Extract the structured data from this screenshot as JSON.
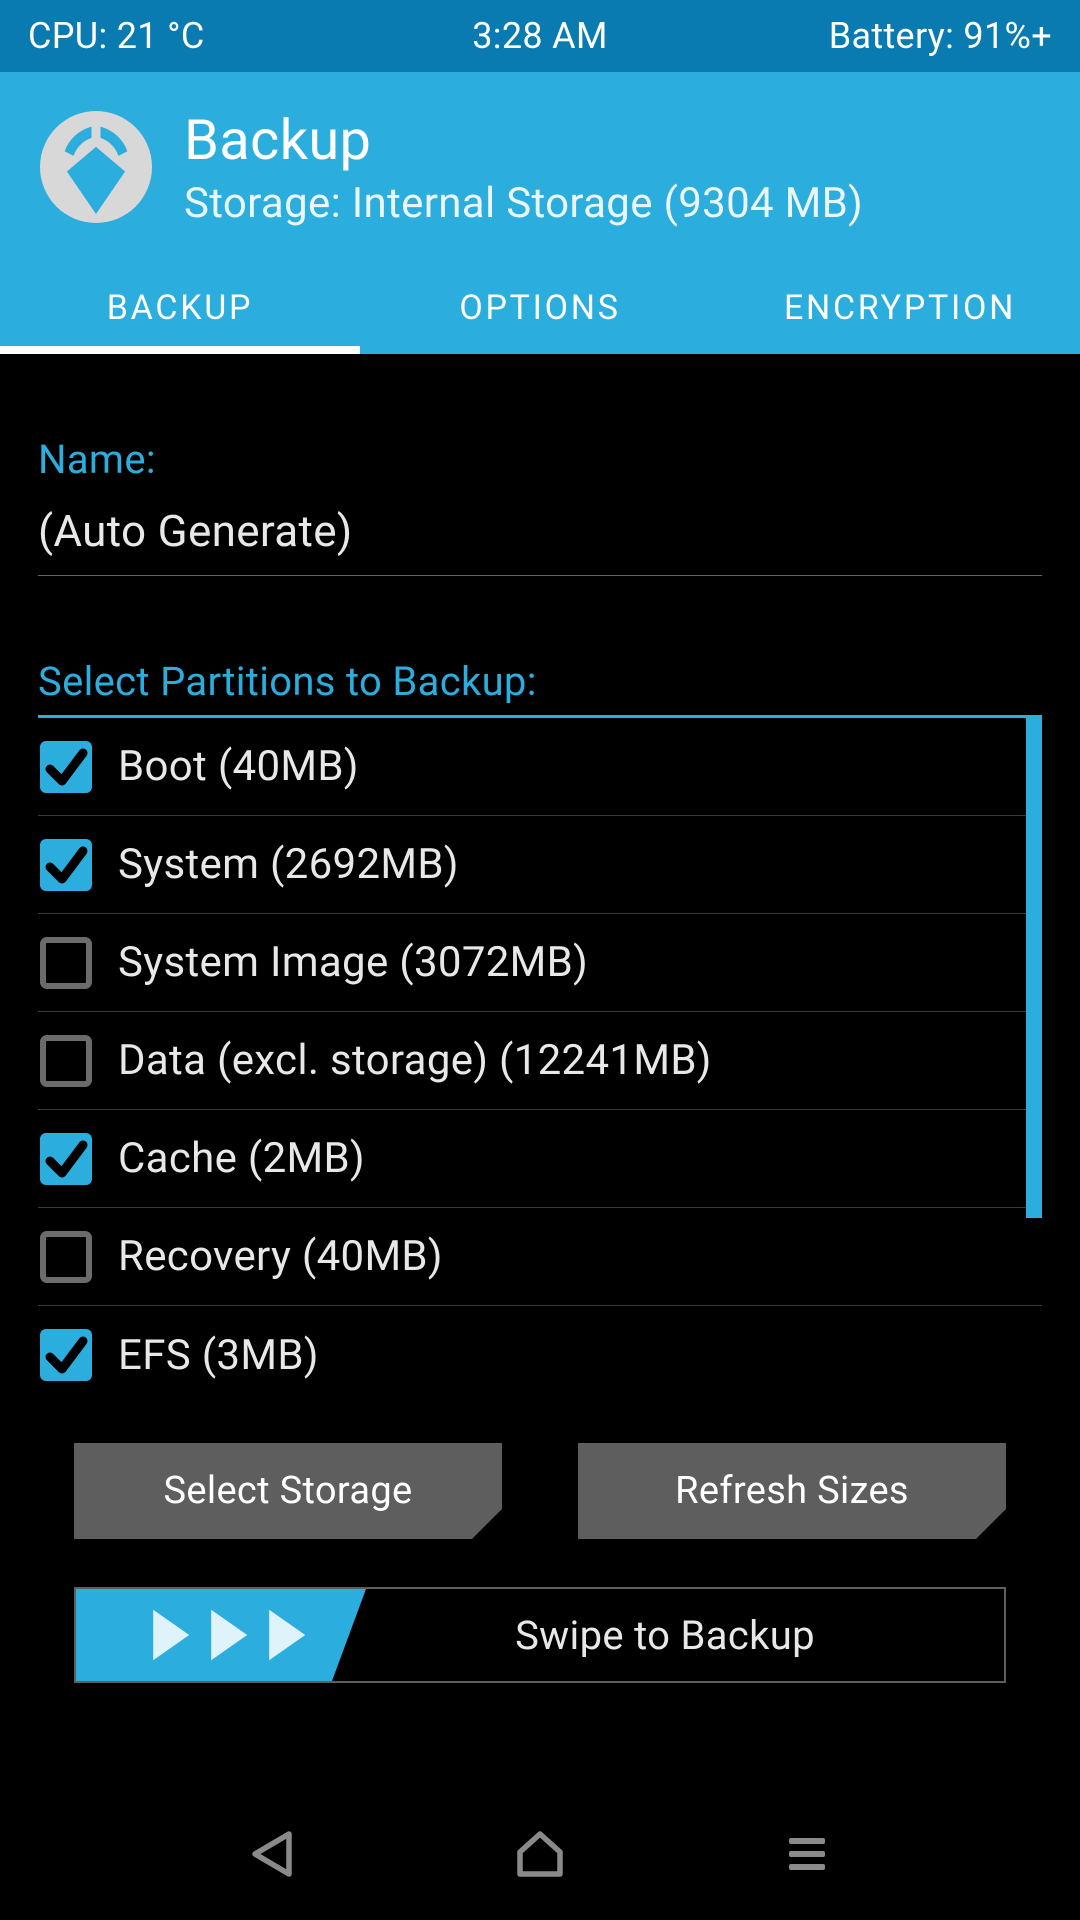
{
  "status": {
    "cpu": "CPU: 21 °C",
    "time": "3:28 AM",
    "battery": "Battery: 91%+"
  },
  "header": {
    "title": "Backup",
    "subtitle": "Storage: Internal Storage (9304 MB)"
  },
  "tabs": {
    "backup": "BACKUP",
    "options": "OPTIONS",
    "encryption": "ENCRYPTION"
  },
  "name_field": {
    "label": "Name:",
    "value": "(Auto Generate)"
  },
  "partitions": {
    "heading": "Select Partitions to Backup:",
    "items": [
      {
        "label": "Boot (40MB)",
        "checked": true
      },
      {
        "label": "System (2692MB)",
        "checked": true
      },
      {
        "label": "System Image (3072MB)",
        "checked": false
      },
      {
        "label": "Data (excl. storage) (12241MB)",
        "checked": false
      },
      {
        "label": "Cache (2MB)",
        "checked": true
      },
      {
        "label": "Recovery (40MB)",
        "checked": false
      },
      {
        "label": "EFS (3MB)",
        "checked": true
      }
    ]
  },
  "buttons": {
    "select_storage": "Select Storage",
    "refresh_sizes": "Refresh Sizes"
  },
  "swipe": {
    "label": "Swipe to Backup"
  },
  "colors": {
    "accent": "#2badde",
    "status_bar": "#0a7bb1",
    "button_grey": "#5e5e5e"
  }
}
